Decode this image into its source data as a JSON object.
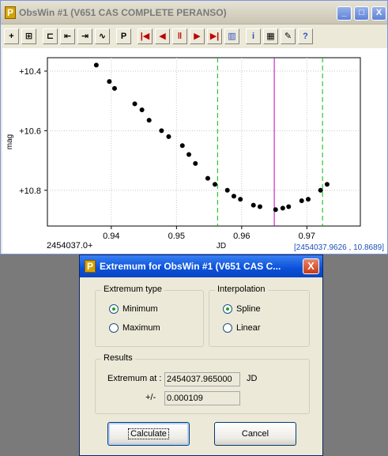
{
  "window": {
    "title": "ObsWin #1 (V651 CAS COMPLETE PERANSO)",
    "app_icon": "P",
    "caption_buttons": [
      "_",
      "□",
      "X"
    ]
  },
  "toolbar": {
    "buttons": [
      {
        "name": "zoom-in-icon",
        "glyph": "+"
      },
      {
        "name": "grid-icon",
        "glyph": "⊞"
      },
      {
        "name": "sep"
      },
      {
        "name": "select-icon",
        "glyph": "⊏"
      },
      {
        "name": "cursor-left-icon",
        "glyph": "⇤"
      },
      {
        "name": "cursor-right-icon",
        "glyph": "⇥"
      },
      {
        "name": "wave-icon",
        "glyph": "∿"
      },
      {
        "name": "sep"
      },
      {
        "name": "p-icon",
        "glyph": "P"
      },
      {
        "name": "sep"
      },
      {
        "name": "first-icon",
        "glyph": "|◀"
      },
      {
        "name": "prev-icon",
        "glyph": "◀"
      },
      {
        "name": "pause-icon",
        "glyph": "‖"
      },
      {
        "name": "next-icon",
        "glyph": "▶"
      },
      {
        "name": "last-icon",
        "glyph": "▶|"
      },
      {
        "name": "book-icon",
        "glyph": "▥"
      },
      {
        "name": "sep"
      },
      {
        "name": "info-icon",
        "glyph": "i"
      },
      {
        "name": "table-icon",
        "glyph": "▦"
      },
      {
        "name": "edit-icon",
        "glyph": "✎"
      },
      {
        "name": "help-icon",
        "glyph": "?"
      }
    ]
  },
  "chart_data": {
    "type": "scatter",
    "title": "",
    "xlabel": "JD",
    "ylabel": "mag",
    "x_origin_label": "2454037.0+",
    "xlim": [
      0.9302,
      0.9782
    ],
    "ylim": [
      10.355,
      10.92
    ],
    "y_inverted": true,
    "x_ticks": [
      0.94,
      0.95,
      0.96,
      0.97
    ],
    "x_tick_labels": [
      "0.94",
      "0.95",
      "0.96",
      "0.97"
    ],
    "y_ticks": [
      10.4,
      10.6,
      10.8
    ],
    "y_tick_labels": [
      "+10.4",
      "+10.6",
      "+10.8"
    ],
    "points": [
      {
        "x": 0.9333,
        "y": 10.31
      },
      {
        "x": 0.9377,
        "y": 10.38
      },
      {
        "x": 0.9397,
        "y": 10.435
      },
      {
        "x": 0.9405,
        "y": 10.458
      },
      {
        "x": 0.9436,
        "y": 10.51
      },
      {
        "x": 0.9447,
        "y": 10.53
      },
      {
        "x": 0.9458,
        "y": 10.565
      },
      {
        "x": 0.9477,
        "y": 10.6
      },
      {
        "x": 0.9488,
        "y": 10.62
      },
      {
        "x": 0.9509,
        "y": 10.65
      },
      {
        "x": 0.9519,
        "y": 10.68
      },
      {
        "x": 0.9529,
        "y": 10.71
      },
      {
        "x": 0.9548,
        "y": 10.76
      },
      {
        "x": 0.9559,
        "y": 10.78
      },
      {
        "x": 0.9578,
        "y": 10.8
      },
      {
        "x": 0.9588,
        "y": 10.82
      },
      {
        "x": 0.9598,
        "y": 10.83
      },
      {
        "x": 0.9618,
        "y": 10.85
      },
      {
        "x": 0.9628,
        "y": 10.855
      },
      {
        "x": 0.9652,
        "y": 10.865
      },
      {
        "x": 0.9663,
        "y": 10.86
      },
      {
        "x": 0.9672,
        "y": 10.855
      },
      {
        "x": 0.9692,
        "y": 10.835
      },
      {
        "x": 0.9702,
        "y": 10.83
      },
      {
        "x": 0.9721,
        "y": 10.8
      },
      {
        "x": 0.9731,
        "y": 10.78
      }
    ],
    "vertical_lines": [
      {
        "x": 0.9563,
        "color": "#00bb00",
        "style": "dashed"
      },
      {
        "x": 0.965,
        "color": "#c000c0",
        "style": "solid"
      },
      {
        "x": 0.9724,
        "color": "#00bb00",
        "style": "dashed"
      }
    ],
    "cursor_readout": "[2454037.9626 , 10.8689]",
    "grid": true,
    "colors": {
      "points": "#000000",
      "grid": "#c8c8c8"
    }
  },
  "dialog": {
    "title": "Extremum for ObsWin #1 (V651 CAS C...",
    "app_icon": "P",
    "close_glyph": "X",
    "extremum_type": {
      "legend": "Extremum type",
      "options": [
        "Minimum",
        "Maximum"
      ],
      "selected": "Minimum"
    },
    "interpolation": {
      "legend": "Interpolation",
      "options": [
        "Spline",
        "Linear"
      ],
      "selected": "Spline"
    },
    "results": {
      "legend": "Results",
      "extremum_label": "Extremum at :",
      "extremum_value": "2454037.965000",
      "unit": "JD",
      "error_label": "+/-",
      "error_value": "0.000109"
    },
    "calculate_label": "Calculate",
    "cancel_label": "Cancel"
  }
}
